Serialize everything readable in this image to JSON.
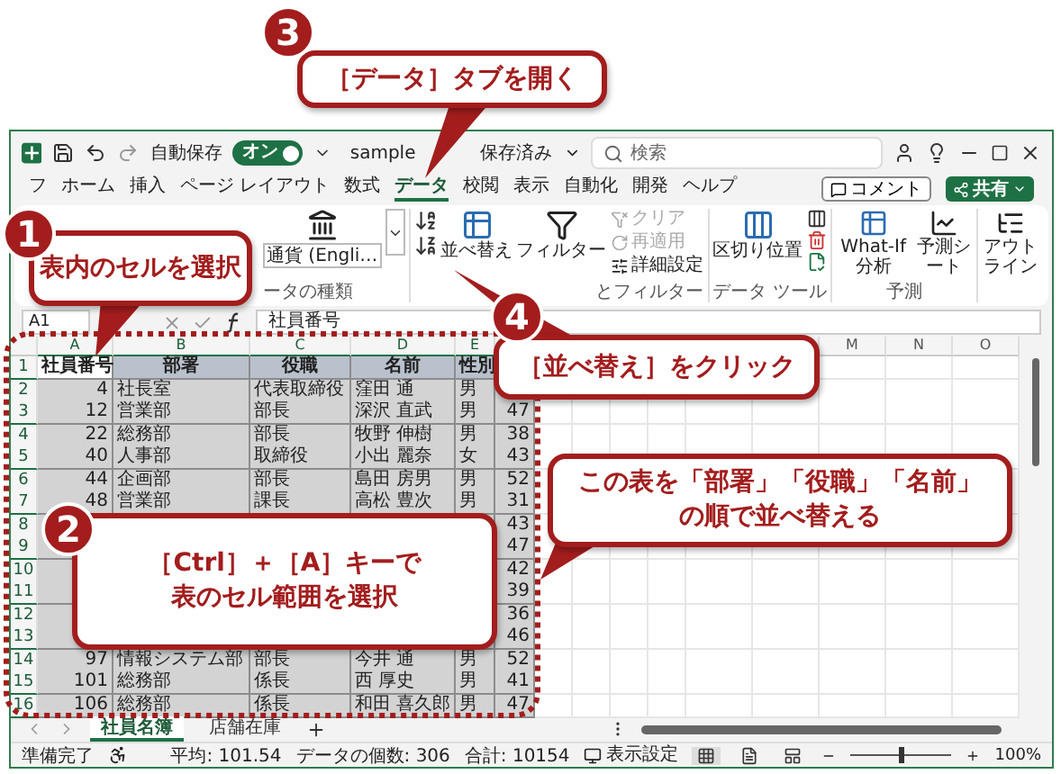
{
  "title_bar": {
    "autosave": {
      "label": "自動保存",
      "on": true,
      "state_text": "オン"
    },
    "file_name": "sample",
    "save_status": "保存済み",
    "search": {
      "placeholder": "検索"
    }
  },
  "ribbon_tabs": [
    {
      "label": "フ",
      "selected": false
    },
    {
      "label": "ホーム",
      "selected": false
    },
    {
      "label": "挿入",
      "selected": false
    },
    {
      "label": "ページ レイアウト",
      "selected": false
    },
    {
      "label": "数式",
      "selected": false
    },
    {
      "label": "データ",
      "selected": true
    },
    {
      "label": "校閲",
      "selected": false
    },
    {
      "label": "表示",
      "selected": false
    },
    {
      "label": "自動化",
      "selected": false
    },
    {
      "label": "開発",
      "selected": false
    },
    {
      "label": "ヘルプ",
      "selected": false
    }
  ],
  "comment_button": "コメント",
  "share_button": "共有",
  "ribbon": {
    "data_types": {
      "format": "通貨 (Engli…",
      "group": "ータの種類"
    },
    "sort_filter": {
      "sort": "並べ替え",
      "filter": "フィルター",
      "clear": {
        "label": "クリア",
        "disabled": true
      },
      "reapply": {
        "label": "再適用",
        "disabled": true
      },
      "advanced": {
        "label": "詳細設定",
        "disabled": false
      },
      "group": "とフィルター"
    },
    "data_tools": {
      "text_to_columns": "区切り位置",
      "group": "データ ツール"
    },
    "forecast": {
      "what_if": "What-If 分析",
      "sheet": "予測シート",
      "group": "予測"
    },
    "outline": {
      "label": "アウトライン"
    }
  },
  "formula_bar": {
    "name_box": "A1",
    "formula": "社員番号"
  },
  "grid": {
    "table_selected": true,
    "headers_left": [
      "A",
      "B",
      "C",
      "D",
      "E"
    ],
    "headers_right": [
      "M",
      "N",
      "O"
    ],
    "rows": [
      {
        "row": "1",
        "kind": "header",
        "employee_no": "社員番号",
        "department": "部署",
        "position": "役職",
        "name": "名前",
        "gender": "性別"
      },
      {
        "row": "2",
        "kind": "data",
        "employee_no": "4",
        "department": "社長室",
        "position": "代表取締役",
        "name": "窪田 通",
        "gender": "男"
      },
      {
        "row": "3",
        "kind": "data",
        "employee_no": "12",
        "department": "営業部",
        "position": "部長",
        "name": "深沢 直武",
        "gender": "男",
        "column_6": "47"
      },
      {
        "row": "4",
        "kind": "data",
        "employee_no": "22",
        "department": "総務部",
        "position": "部長",
        "name": "牧野 伸樹",
        "gender": "男",
        "column_6": "38"
      },
      {
        "row": "5",
        "kind": "data",
        "employee_no": "40",
        "department": "人事部",
        "position": "取締役",
        "name": "小出 麗奈",
        "gender": "女",
        "column_6": "43"
      },
      {
        "row": "6",
        "kind": "data",
        "employee_no": "44",
        "department": "企画部",
        "position": "部長",
        "name": "島田 房男",
        "gender": "男",
        "column_6": "52"
      },
      {
        "row": "7",
        "kind": "data",
        "employee_no": "48",
        "department": "営業部",
        "position": "課長",
        "name": "高松 豊次",
        "gender": "男",
        "column_6": "31"
      },
      {
        "row": "8",
        "kind": "data",
        "column_6": "43"
      },
      {
        "row": "9",
        "kind": "data",
        "column_6": "47"
      },
      {
        "row": "10",
        "kind": "data",
        "column_6": "42"
      },
      {
        "row": "11",
        "kind": "data",
        "column_6": "39"
      },
      {
        "row": "12",
        "kind": "data",
        "column_6": "36"
      },
      {
        "row": "13",
        "kind": "data",
        "column_6": "46"
      },
      {
        "row": "14",
        "kind": "data",
        "employee_no": "97",
        "department": "情報システム部",
        "position": "部長",
        "name": "今井 通",
        "gender": "男",
        "column_6": "52"
      },
      {
        "row": "15",
        "kind": "data",
        "employee_no": "101",
        "department": "総務部",
        "position": "係長",
        "name": "西 厚史",
        "gender": "男",
        "column_6": "41"
      },
      {
        "row": "16",
        "kind": "data",
        "employee_no": "106",
        "department": "総務部",
        "position": "係長",
        "name": "和田 喜久郎",
        "gender": "男",
        "column_6": "47"
      }
    ]
  },
  "sheet_tabs": [
    {
      "label": "社員名簿",
      "selected": true
    },
    {
      "label": "店舗在庫",
      "selected": false
    }
  ],
  "status_bar": {
    "ready": "準備完了",
    "stats": [
      "平均: 101.54",
      "データの個数: 306",
      "合計: 10154"
    ],
    "display_settings": "表示設定",
    "zoom": {
      "level": 0.5,
      "reading": "100%"
    }
  },
  "callouts": [
    {
      "number": "3",
      "lines": [
        "［データ］タブを開く"
      ]
    },
    {
      "number": "1",
      "lines": [
        "表内のセルを選択"
      ]
    },
    {
      "number": "4",
      "lines": [
        "［並べ替え］をクリック"
      ]
    },
    {
      "lines": [
        "この表を「部署」「役職」「名前」",
        "の順で並べ替える"
      ]
    },
    {
      "number": "2",
      "lines": [
        "［Ctrl］＋［A］キーで",
        "表のセル範囲を選択"
      ]
    }
  ]
}
